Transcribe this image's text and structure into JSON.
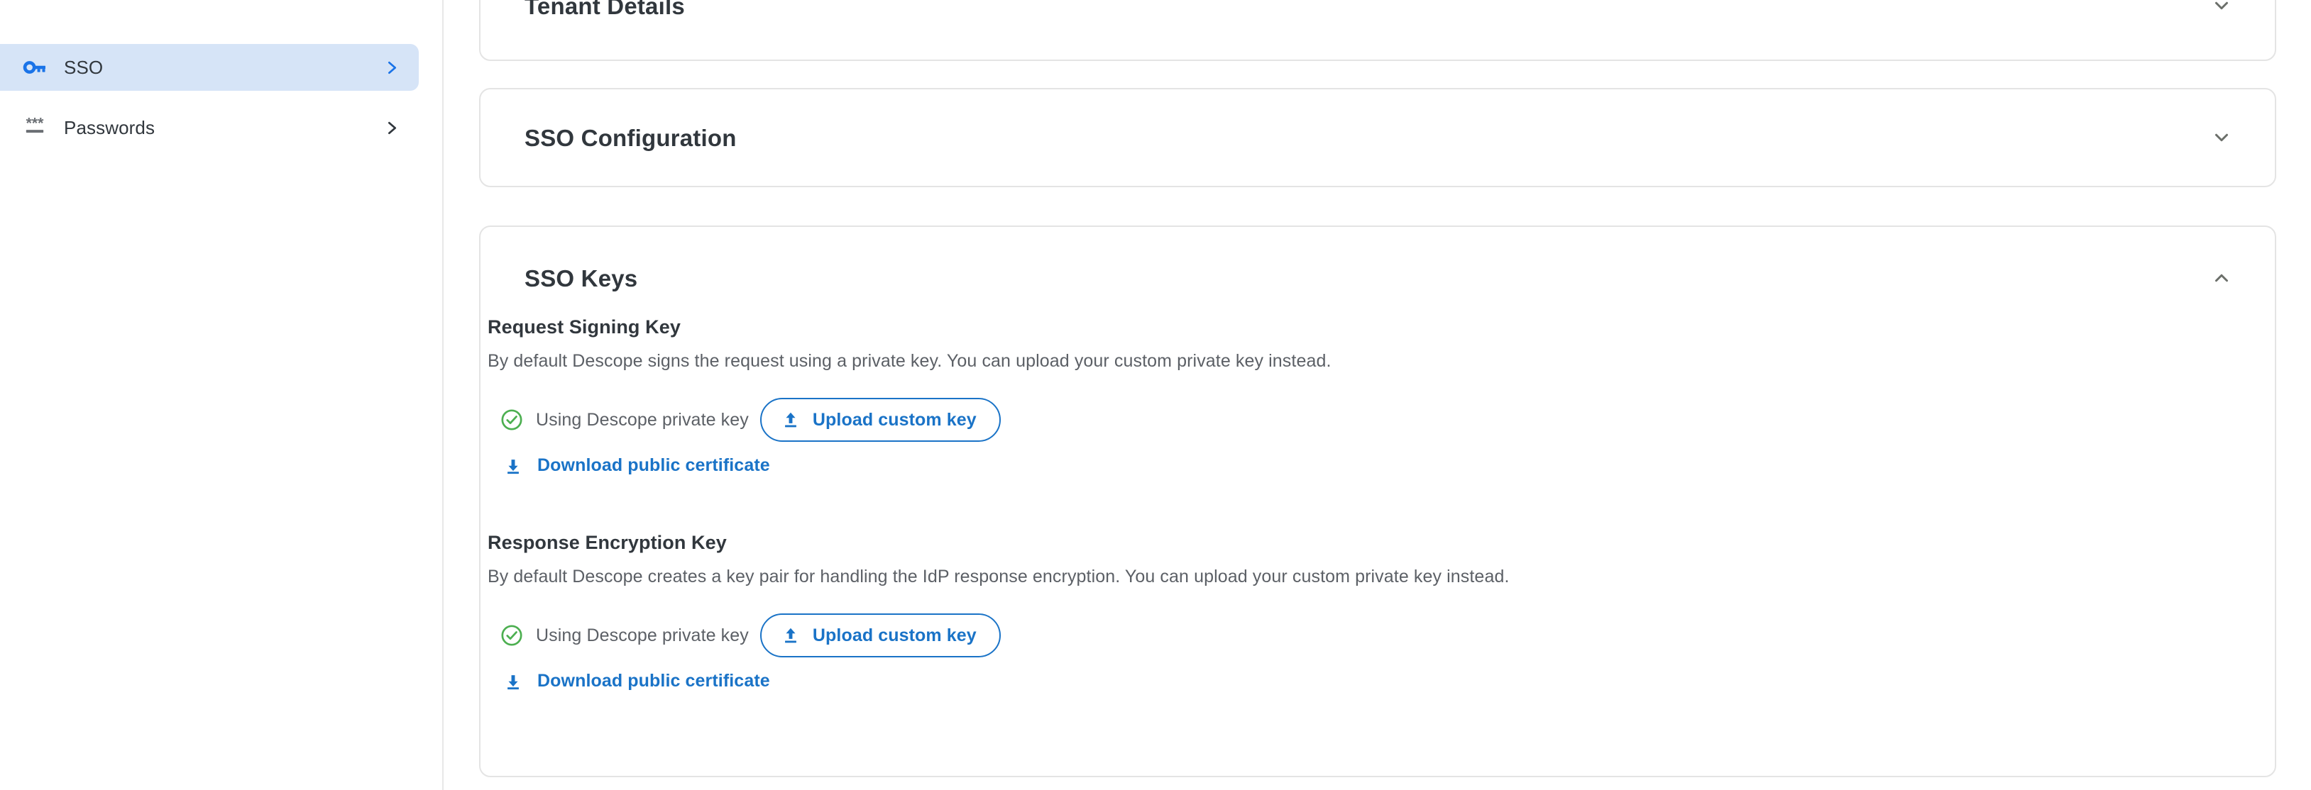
{
  "colors": {
    "accent_blue": "#1a73c7",
    "nav_active_bg": "#d6e4f7",
    "nav_active_icon": "#1a73e8",
    "success_green": "#4caf50",
    "text_primary": "#31373d",
    "text_secondary": "#5c6066",
    "card_border": "#e4e4e4"
  },
  "sidebar": {
    "items": [
      {
        "label": "SSO",
        "icon": "key-icon",
        "chevron": "chevron-right-icon",
        "active": true
      },
      {
        "label": "Passwords",
        "icon": "password-asterisks-icon",
        "chevron": "chevron-right-icon",
        "active": false
      }
    ]
  },
  "main": {
    "cards": [
      {
        "title": "Tenant Details",
        "toggle_icon": "chevron-down-icon",
        "expanded": false
      },
      {
        "title": "SSO Configuration",
        "toggle_icon": "chevron-down-icon",
        "expanded": false
      },
      {
        "title": "SSO Keys",
        "toggle_icon": "chevron-up-icon",
        "expanded": true
      }
    ],
    "sso_keys": {
      "title": "SSO Keys",
      "blocks": [
        {
          "title": "Request Signing Key",
          "description": "By default Descope signs the request using a private key. You can upload your custom private key instead.",
          "status_text": "Using Descope private key",
          "status_icon": "check-circle-icon",
          "upload_button": {
            "label": "Upload custom key",
            "icon": "upload-icon"
          },
          "download_link": {
            "label": "Download public certificate",
            "icon": "download-icon"
          }
        },
        {
          "title": "Response Encryption Key",
          "description": "By default Descope creates a key pair for handling the IdP response encryption. You can upload your custom private key instead.",
          "status_text": "Using Descope private key",
          "status_icon": "check-circle-icon",
          "upload_button": {
            "label": "Upload custom key",
            "icon": "upload-icon"
          },
          "download_link": {
            "label": "Download public certificate",
            "icon": "download-icon"
          }
        }
      ]
    }
  }
}
